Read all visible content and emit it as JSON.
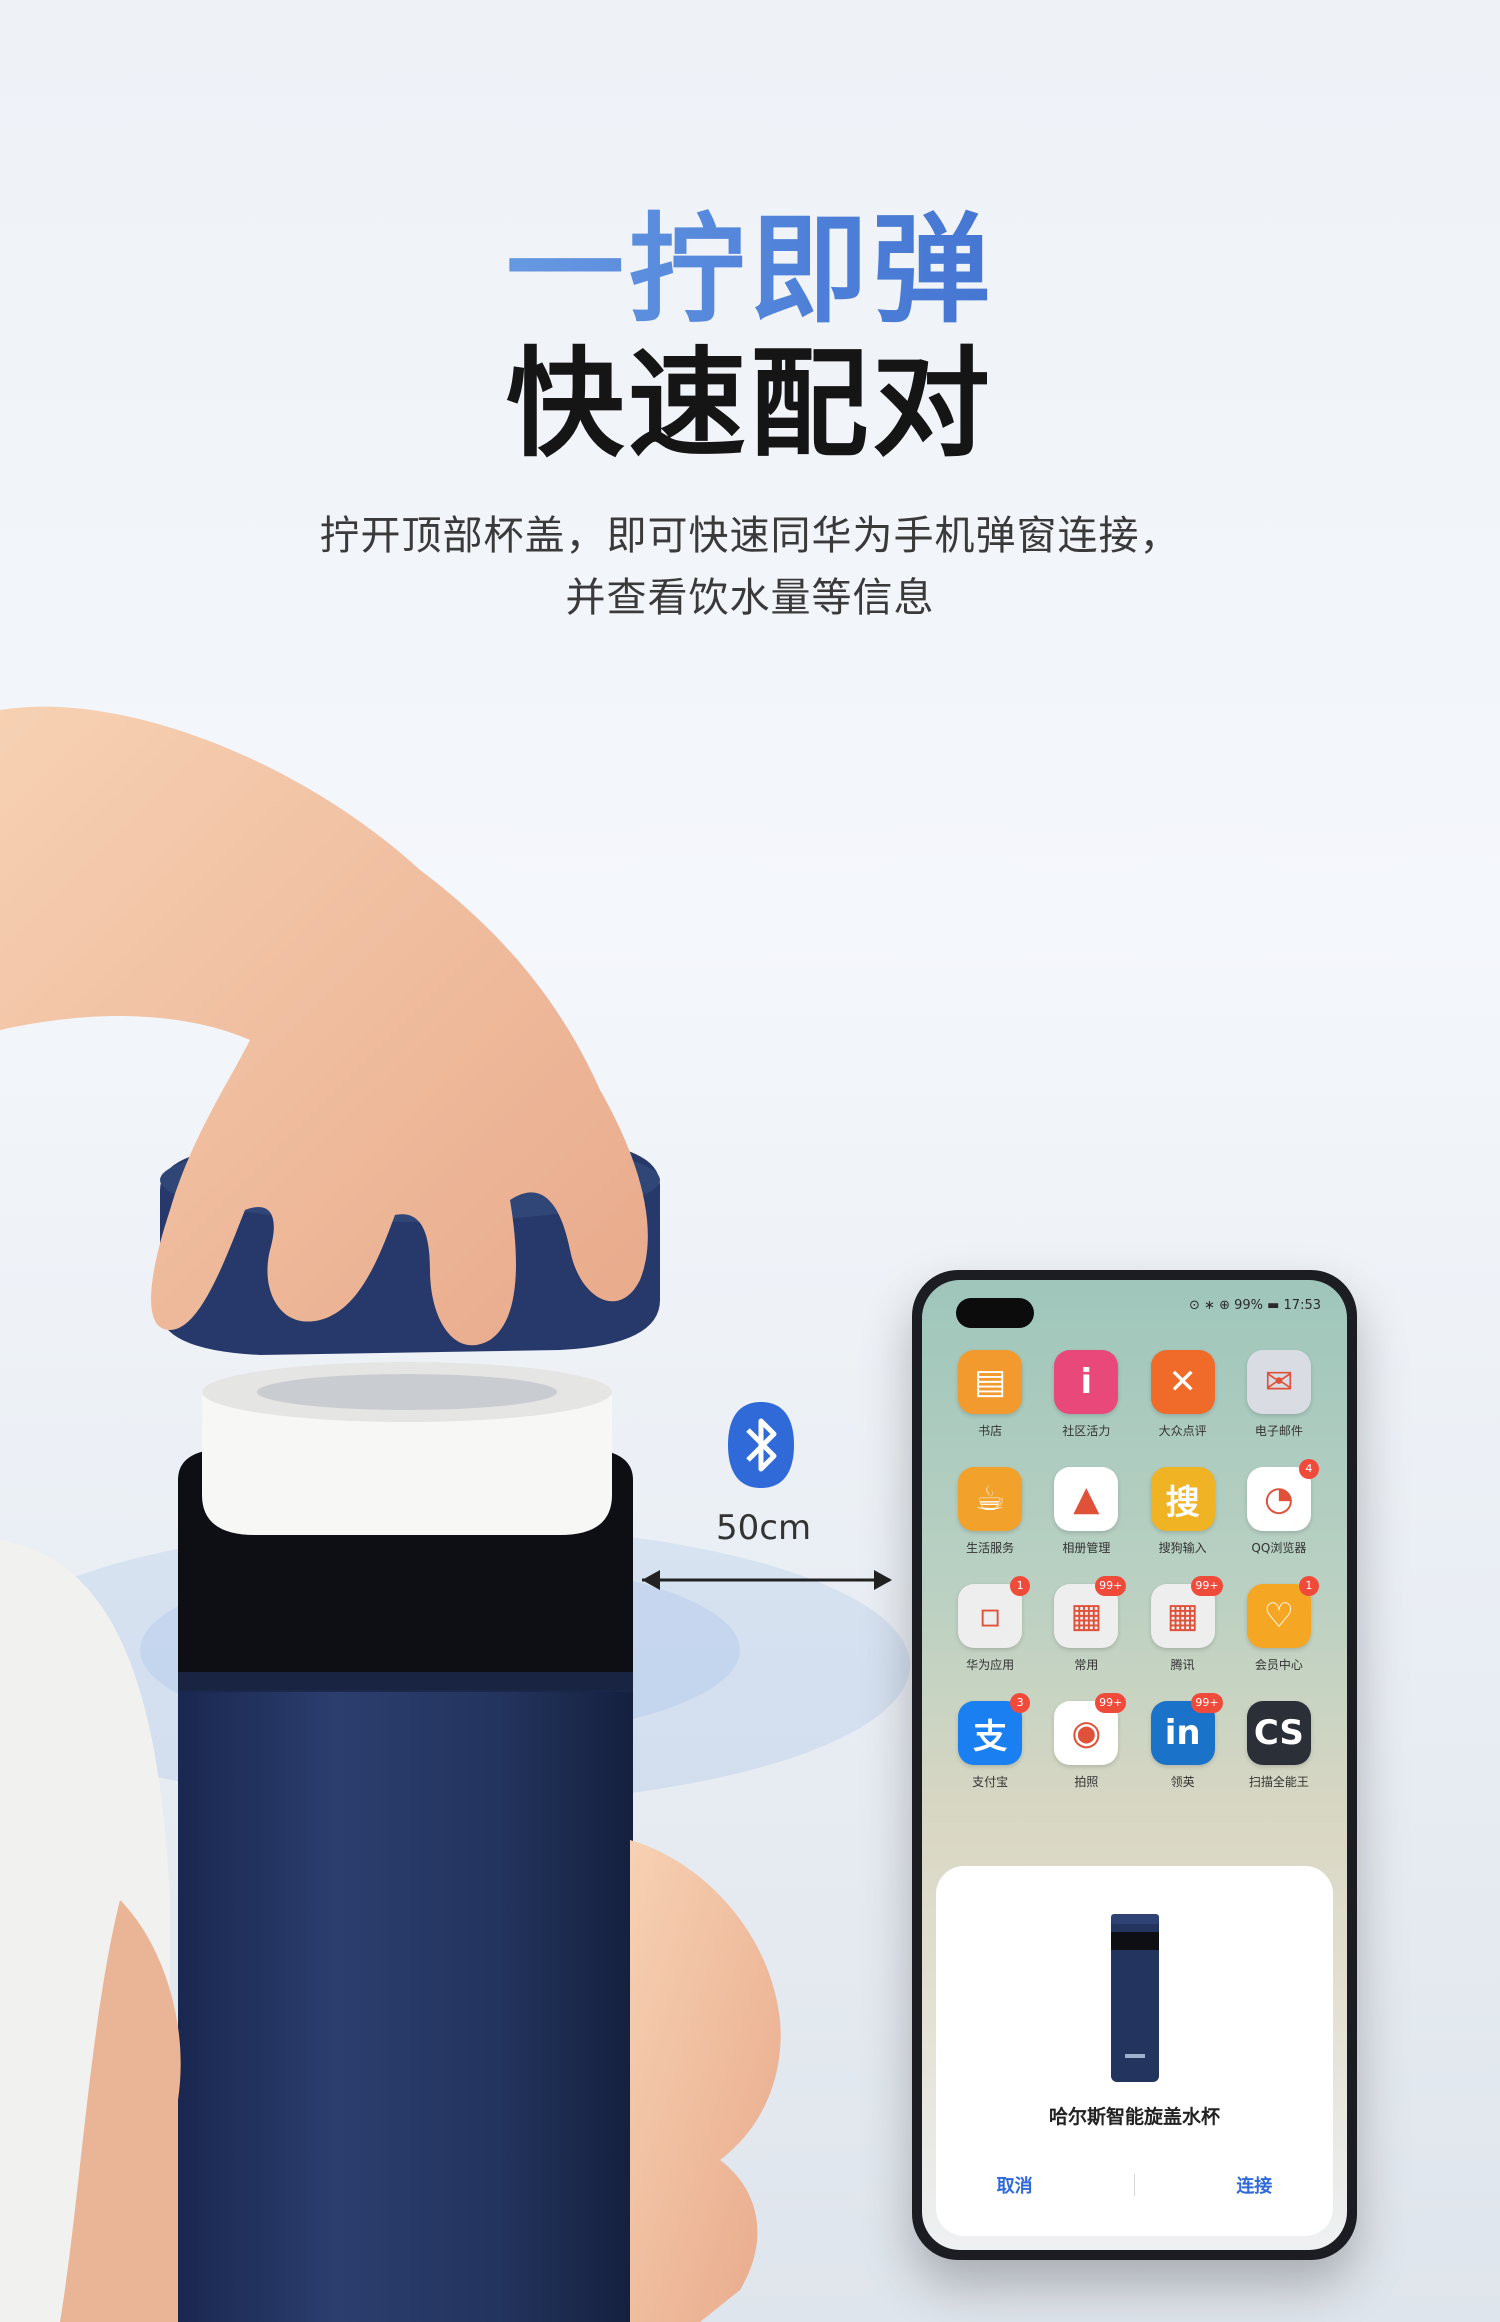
{
  "headline": {
    "line1": "一拧即弹",
    "line2": "快速配对"
  },
  "description": {
    "line1": "拧开顶部杯盖，即可快速同华为手机弹窗连接，",
    "line2": "并查看饮水量等信息"
  },
  "connection": {
    "distance": "50cm",
    "icon": "bluetooth-icon"
  },
  "phone": {
    "status": "⊙ ∗ ⊕ 99% ▬ 17:53",
    "apps": [
      {
        "icon": "books-icon",
        "glyph": "▤",
        "color": "#f29a2e",
        "label": "书店",
        "badge": ""
      },
      {
        "icon": "theme-icon",
        "glyph": "i",
        "color": "#e8487a",
        "label": "社区活力",
        "badge": ""
      },
      {
        "icon": "run-icon",
        "glyph": "✕",
        "color": "#f06a2a",
        "label": "大众点评",
        "badge": ""
      },
      {
        "icon": "mail-icon",
        "glyph": "✉",
        "color": "#d9dde3",
        "label": "电子邮件",
        "badge": ""
      },
      {
        "icon": "coffee-icon",
        "glyph": "☕",
        "color": "#f2a12b",
        "label": "生活服务",
        "badge": ""
      },
      {
        "icon": "gallery-icon",
        "glyph": "▲",
        "color": "#ffffff",
        "label": "相册管理",
        "badge": ""
      },
      {
        "icon": "sogou-icon",
        "glyph": "搜",
        "color": "#f0b324",
        "label": "搜狗输入",
        "badge": ""
      },
      {
        "icon": "browser-icon",
        "glyph": "◔",
        "color": "#ffffff",
        "label": "QQ浏览器",
        "badge": "4"
      },
      {
        "icon": "folder-icon",
        "glyph": "▫",
        "color": "#eeeeee",
        "label": "华为应用",
        "badge": "1"
      },
      {
        "icon": "folder-icon",
        "glyph": "▦",
        "color": "#eeeeee",
        "label": "常用",
        "badge": "99+"
      },
      {
        "icon": "folder-icon",
        "glyph": "▦",
        "color": "#eeeeee",
        "label": "腾讯",
        "badge": "99+"
      },
      {
        "icon": "vip-icon",
        "glyph": "♡",
        "color": "#f5a623",
        "label": "会员中心",
        "badge": "1"
      },
      {
        "icon": "alipay-icon",
        "glyph": "支",
        "color": "#1a7ff0",
        "label": "支付宝",
        "badge": "3"
      },
      {
        "icon": "camera-icon",
        "glyph": "◉",
        "color": "#ffffff",
        "label": "拍照",
        "badge": "99+"
      },
      {
        "icon": "linkedin-icon",
        "glyph": "in",
        "color": "#1a73c8",
        "label": "领英",
        "badge": "99+"
      },
      {
        "icon": "camscanner-icon",
        "glyph": "CS",
        "color": "#2b2f38",
        "label": "扫描全能王",
        "badge": ""
      }
    ],
    "dialog": {
      "device_name": "哈尔斯智能旋盖水杯",
      "cancel": "取消",
      "connect": "连接"
    }
  },
  "colors": {
    "bottle": "#23345e",
    "accent": "#2f6ad8",
    "headline_gradient": [
      "#8fc2f2",
      "#2f5bbf"
    ]
  }
}
